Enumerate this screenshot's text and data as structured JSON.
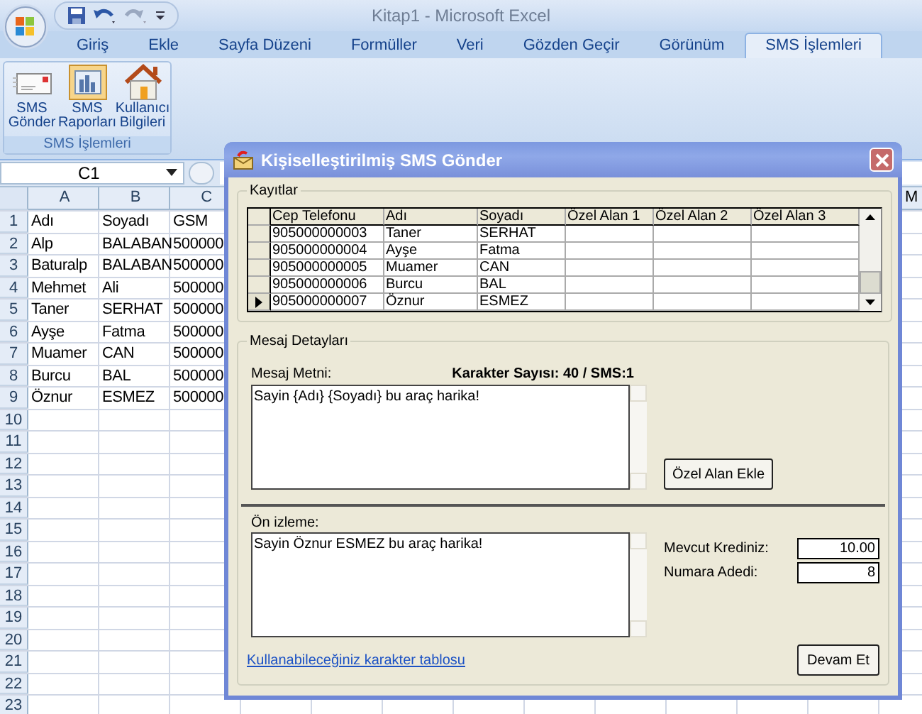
{
  "window": {
    "title": "Kitap1 - Microsoft Excel"
  },
  "tabs": [
    {
      "label": "Giriş",
      "selected": false
    },
    {
      "label": "Ekle",
      "selected": false
    },
    {
      "label": "Sayfa Düzeni",
      "selected": false
    },
    {
      "label": "Formüller",
      "selected": false
    },
    {
      "label": "Veri",
      "selected": false
    },
    {
      "label": "Gözden Geçir",
      "selected": false
    },
    {
      "label": "Görünüm",
      "selected": false
    },
    {
      "label": "SMS İşlemleri",
      "selected": true
    }
  ],
  "ribbon": {
    "group_label": "SMS İşlemleri",
    "buttons": [
      {
        "kind": "envelope",
        "lines": [
          "SMS",
          "Gönder"
        ]
      },
      {
        "kind": "chart",
        "lines": [
          "SMS",
          "Raporları"
        ]
      },
      {
        "kind": "house",
        "lines": [
          "Kullanıcı",
          "Bilgileri"
        ]
      }
    ]
  },
  "formula_bar": {
    "name_box": "C1"
  },
  "sheet": {
    "columns": [
      "A",
      "B",
      "C"
    ],
    "last_column": "M",
    "rows": [
      {
        "number": "1",
        "cells": [
          "Adı",
          "Soyadı",
          "GSM"
        ]
      },
      {
        "number": "2",
        "cells": [
          "Alp",
          "BALABAN",
          "500000"
        ]
      },
      {
        "number": "3",
        "cells": [
          "Baturalp",
          "BALABAN",
          "500000"
        ]
      },
      {
        "number": "4",
        "cells": [
          "Mehmet",
          "Ali",
          "500000"
        ]
      },
      {
        "number": "5",
        "cells": [
          "Taner",
          "SERHAT",
          "500000"
        ]
      },
      {
        "number": "6",
        "cells": [
          "Ayşe",
          "Fatma",
          "500000"
        ]
      },
      {
        "number": "7",
        "cells": [
          "Muamer",
          "CAN",
          "500000"
        ]
      },
      {
        "number": "8",
        "cells": [
          "Burcu",
          "BAL",
          "500000"
        ]
      },
      {
        "number": "9",
        "cells": [
          "Öznur",
          "ESMEZ",
          "500000"
        ]
      },
      {
        "number": "10",
        "cells": []
      },
      {
        "number": "11",
        "cells": []
      },
      {
        "number": "12",
        "cells": []
      },
      {
        "number": "13",
        "cells": []
      },
      {
        "number": "14",
        "cells": []
      },
      {
        "number": "15",
        "cells": []
      },
      {
        "number": "16",
        "cells": []
      },
      {
        "number": "17",
        "cells": []
      },
      {
        "number": "18",
        "cells": []
      },
      {
        "number": "19",
        "cells": []
      },
      {
        "number": "20",
        "cells": []
      },
      {
        "number": "21",
        "cells": []
      },
      {
        "number": "22",
        "cells": []
      },
      {
        "number": "23",
        "cells": []
      }
    ]
  },
  "dialog": {
    "title": "Kişiselleştirilmiş SMS Gönder",
    "records": {
      "label": "Kayıtlar",
      "columns": [
        "Cep Telefonu",
        "Adı",
        "Soyadı",
        "Özel Alan 1",
        "Özel Alan 2",
        "Özel Alan 3"
      ],
      "rows": [
        {
          "selected": false,
          "cells": [
            "905000000003",
            "Taner",
            "SERHAT"
          ]
        },
        {
          "selected": false,
          "cells": [
            "905000000004",
            "Ayşe",
            "Fatma"
          ]
        },
        {
          "selected": false,
          "cells": [
            "905000000005",
            "Muamer",
            "CAN"
          ]
        },
        {
          "selected": false,
          "cells": [
            "905000000006",
            "Burcu",
            "BAL"
          ]
        },
        {
          "selected": true,
          "cells": [
            "905000000007",
            "Öznur",
            "ESMEZ"
          ]
        }
      ]
    },
    "details": {
      "label": "Mesaj Detayları",
      "message_label": "Mesaj Metni:",
      "char_count": "Karakter Sayısı: 40 / SMS:1",
      "message": "Sayin {Adı} {Soyadı} bu araç harika!",
      "add_field_button": "Özel Alan Ekle",
      "preview_label": "Ön izleme:",
      "preview": "Sayin Öznur ESMEZ bu araç harika!",
      "credit_label": "Mevcut Krediniz:",
      "credit": "10.00",
      "count_label": "Numara Adedi:",
      "count": "8",
      "link": "Kullanabileceğiniz karakter tablosu",
      "continue_button": "Devam Et"
    }
  }
}
